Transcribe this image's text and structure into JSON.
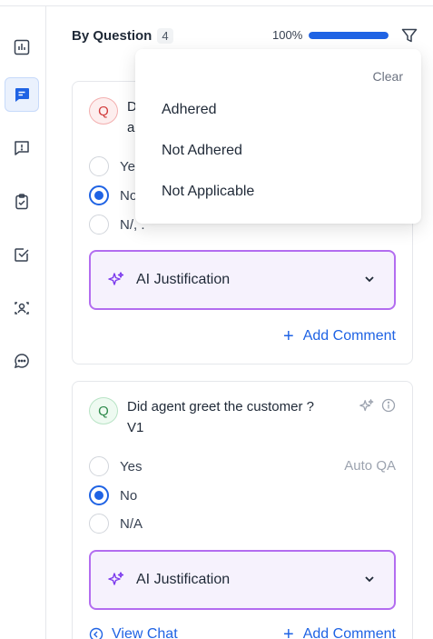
{
  "header": {
    "title": "By Question",
    "count": "4",
    "progress_label": "100%",
    "progress_fraction": 1.0
  },
  "filter_dropdown": {
    "clear_label": "Clear",
    "options": [
      "Adhered",
      "Not Adhered",
      "Not Applicable"
    ]
  },
  "cards": [
    {
      "badge": "Q",
      "question_visible": [
        "D",
        "a"
      ],
      "options": [
        {
          "label": "Ye",
          "checked": false
        },
        {
          "label": "No",
          "checked": true
        },
        {
          "label": "N/, .",
          "checked": false
        }
      ],
      "ai_label": "AI Justification",
      "add_comment": "Add Comment"
    },
    {
      "badge": "Q",
      "question": "Did agent greet the customer ?",
      "question_line2": "V1",
      "auto_qa": "Auto QA",
      "options": [
        {
          "label": "Yes",
          "checked": false
        },
        {
          "label": "No",
          "checked": true
        },
        {
          "label": "N/A",
          "checked": false
        }
      ],
      "ai_label": "AI Justification",
      "view_chat": "View Chat",
      "add_comment": "Add Comment"
    }
  ],
  "colors": {
    "accent": "#1f63e4",
    "ai_border": "#b36df0",
    "ai_bg": "#f6f2fd",
    "badge_red": "#d13b3b",
    "badge_green": "#2f8a4c"
  },
  "rail_icons": [
    "bar-chart-icon",
    "message-square-icon",
    "alert-message-icon",
    "clipboard-check-icon",
    "checkbox-icon",
    "user-scan-icon",
    "chat-bubble-icon"
  ]
}
